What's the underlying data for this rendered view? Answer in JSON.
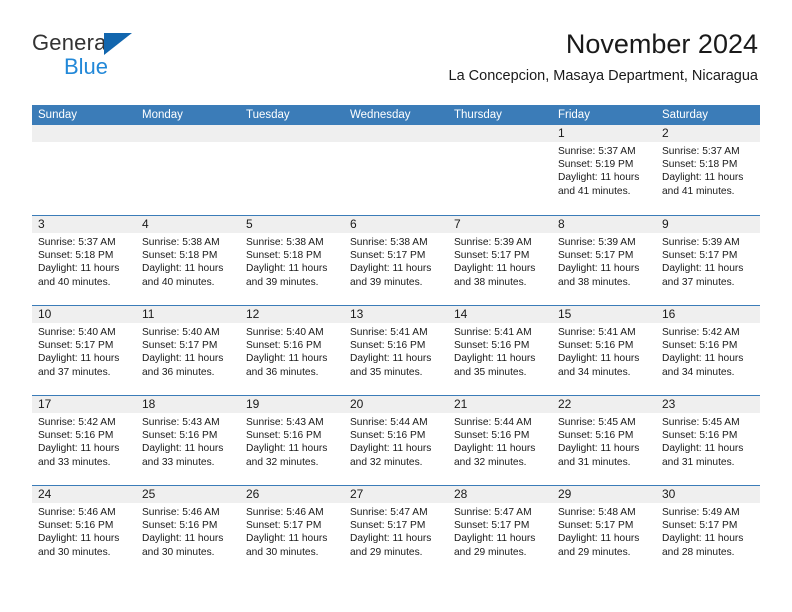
{
  "brand": {
    "name_part1": "General",
    "name_part2": "Blue",
    "triangle_color": "#1266ae",
    "blue_color": "#2288d8"
  },
  "header": {
    "title": "November 2024",
    "subtitle": "La Concepcion, Masaya Department, Nicaragua"
  },
  "theme": {
    "header_blue": "#3b7cb8",
    "date_band_gray": "#efefef",
    "text_color": "#1a1a1a"
  },
  "weekdays": [
    "Sunday",
    "Monday",
    "Tuesday",
    "Wednesday",
    "Thursday",
    "Friday",
    "Saturday"
  ],
  "weeks": [
    [
      {
        "day": "",
        "empty": true
      },
      {
        "day": "",
        "empty": true
      },
      {
        "day": "",
        "empty": true
      },
      {
        "day": "",
        "empty": true
      },
      {
        "day": "",
        "empty": true
      },
      {
        "day": "1",
        "sunrise": "Sunrise: 5:37 AM",
        "sunset": "Sunset: 5:19 PM",
        "daylight1": "Daylight: 11 hours",
        "daylight2": "and 41 minutes."
      },
      {
        "day": "2",
        "sunrise": "Sunrise: 5:37 AM",
        "sunset": "Sunset: 5:18 PM",
        "daylight1": "Daylight: 11 hours",
        "daylight2": "and 41 minutes."
      }
    ],
    [
      {
        "day": "3",
        "sunrise": "Sunrise: 5:37 AM",
        "sunset": "Sunset: 5:18 PM",
        "daylight1": "Daylight: 11 hours",
        "daylight2": "and 40 minutes."
      },
      {
        "day": "4",
        "sunrise": "Sunrise: 5:38 AM",
        "sunset": "Sunset: 5:18 PM",
        "daylight1": "Daylight: 11 hours",
        "daylight2": "and 40 minutes."
      },
      {
        "day": "5",
        "sunrise": "Sunrise: 5:38 AM",
        "sunset": "Sunset: 5:18 PM",
        "daylight1": "Daylight: 11 hours",
        "daylight2": "and 39 minutes."
      },
      {
        "day": "6",
        "sunrise": "Sunrise: 5:38 AM",
        "sunset": "Sunset: 5:17 PM",
        "daylight1": "Daylight: 11 hours",
        "daylight2": "and 39 minutes."
      },
      {
        "day": "7",
        "sunrise": "Sunrise: 5:39 AM",
        "sunset": "Sunset: 5:17 PM",
        "daylight1": "Daylight: 11 hours",
        "daylight2": "and 38 minutes."
      },
      {
        "day": "8",
        "sunrise": "Sunrise: 5:39 AM",
        "sunset": "Sunset: 5:17 PM",
        "daylight1": "Daylight: 11 hours",
        "daylight2": "and 38 minutes."
      },
      {
        "day": "9",
        "sunrise": "Sunrise: 5:39 AM",
        "sunset": "Sunset: 5:17 PM",
        "daylight1": "Daylight: 11 hours",
        "daylight2": "and 37 minutes."
      }
    ],
    [
      {
        "day": "10",
        "sunrise": "Sunrise: 5:40 AM",
        "sunset": "Sunset: 5:17 PM",
        "daylight1": "Daylight: 11 hours",
        "daylight2": "and 37 minutes."
      },
      {
        "day": "11",
        "sunrise": "Sunrise: 5:40 AM",
        "sunset": "Sunset: 5:17 PM",
        "daylight1": "Daylight: 11 hours",
        "daylight2": "and 36 minutes."
      },
      {
        "day": "12",
        "sunrise": "Sunrise: 5:40 AM",
        "sunset": "Sunset: 5:16 PM",
        "daylight1": "Daylight: 11 hours",
        "daylight2": "and 36 minutes."
      },
      {
        "day": "13",
        "sunrise": "Sunrise: 5:41 AM",
        "sunset": "Sunset: 5:16 PM",
        "daylight1": "Daylight: 11 hours",
        "daylight2": "and 35 minutes."
      },
      {
        "day": "14",
        "sunrise": "Sunrise: 5:41 AM",
        "sunset": "Sunset: 5:16 PM",
        "daylight1": "Daylight: 11 hours",
        "daylight2": "and 35 minutes."
      },
      {
        "day": "15",
        "sunrise": "Sunrise: 5:41 AM",
        "sunset": "Sunset: 5:16 PM",
        "daylight1": "Daylight: 11 hours",
        "daylight2": "and 34 minutes."
      },
      {
        "day": "16",
        "sunrise": "Sunrise: 5:42 AM",
        "sunset": "Sunset: 5:16 PM",
        "daylight1": "Daylight: 11 hours",
        "daylight2": "and 34 minutes."
      }
    ],
    [
      {
        "day": "17",
        "sunrise": "Sunrise: 5:42 AM",
        "sunset": "Sunset: 5:16 PM",
        "daylight1": "Daylight: 11 hours",
        "daylight2": "and 33 minutes."
      },
      {
        "day": "18",
        "sunrise": "Sunrise: 5:43 AM",
        "sunset": "Sunset: 5:16 PM",
        "daylight1": "Daylight: 11 hours",
        "daylight2": "and 33 minutes."
      },
      {
        "day": "19",
        "sunrise": "Sunrise: 5:43 AM",
        "sunset": "Sunset: 5:16 PM",
        "daylight1": "Daylight: 11 hours",
        "daylight2": "and 32 minutes."
      },
      {
        "day": "20",
        "sunrise": "Sunrise: 5:44 AM",
        "sunset": "Sunset: 5:16 PM",
        "daylight1": "Daylight: 11 hours",
        "daylight2": "and 32 minutes."
      },
      {
        "day": "21",
        "sunrise": "Sunrise: 5:44 AM",
        "sunset": "Sunset: 5:16 PM",
        "daylight1": "Daylight: 11 hours",
        "daylight2": "and 32 minutes."
      },
      {
        "day": "22",
        "sunrise": "Sunrise: 5:45 AM",
        "sunset": "Sunset: 5:16 PM",
        "daylight1": "Daylight: 11 hours",
        "daylight2": "and 31 minutes."
      },
      {
        "day": "23",
        "sunrise": "Sunrise: 5:45 AM",
        "sunset": "Sunset: 5:16 PM",
        "daylight1": "Daylight: 11 hours",
        "daylight2": "and 31 minutes."
      }
    ],
    [
      {
        "day": "24",
        "sunrise": "Sunrise: 5:46 AM",
        "sunset": "Sunset: 5:16 PM",
        "daylight1": "Daylight: 11 hours",
        "daylight2": "and 30 minutes."
      },
      {
        "day": "25",
        "sunrise": "Sunrise: 5:46 AM",
        "sunset": "Sunset: 5:16 PM",
        "daylight1": "Daylight: 11 hours",
        "daylight2": "and 30 minutes."
      },
      {
        "day": "26",
        "sunrise": "Sunrise: 5:46 AM",
        "sunset": "Sunset: 5:17 PM",
        "daylight1": "Daylight: 11 hours",
        "daylight2": "and 30 minutes."
      },
      {
        "day": "27",
        "sunrise": "Sunrise: 5:47 AM",
        "sunset": "Sunset: 5:17 PM",
        "daylight1": "Daylight: 11 hours",
        "daylight2": "and 29 minutes."
      },
      {
        "day": "28",
        "sunrise": "Sunrise: 5:47 AM",
        "sunset": "Sunset: 5:17 PM",
        "daylight1": "Daylight: 11 hours",
        "daylight2": "and 29 minutes."
      },
      {
        "day": "29",
        "sunrise": "Sunrise: 5:48 AM",
        "sunset": "Sunset: 5:17 PM",
        "daylight1": "Daylight: 11 hours",
        "daylight2": "and 29 minutes."
      },
      {
        "day": "30",
        "sunrise": "Sunrise: 5:49 AM",
        "sunset": "Sunset: 5:17 PM",
        "daylight1": "Daylight: 11 hours",
        "daylight2": "and 28 minutes."
      }
    ]
  ]
}
